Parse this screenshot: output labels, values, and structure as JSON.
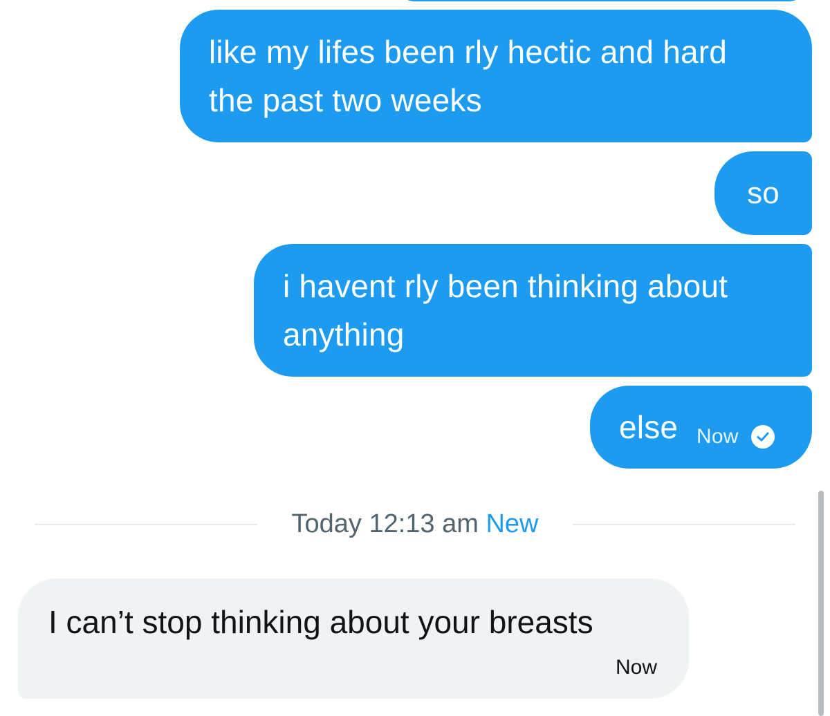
{
  "colors": {
    "sent_bubble": "#1d9bf0",
    "received_bubble": "#eff3f4",
    "divider_text": "#536471",
    "new_accent": "#1d9bf0"
  },
  "messages": [
    {
      "direction": "sent",
      "lines": [
        "like my lifes been rly hectic and hard",
        "the past two weeks"
      ]
    },
    {
      "direction": "sent",
      "lines": [
        "so"
      ]
    },
    {
      "direction": "sent",
      "lines": [
        "i havent rly been thinking about",
        "anything"
      ]
    },
    {
      "direction": "sent",
      "lines": [
        "else"
      ],
      "time": "Now",
      "status_icon": "check-circle-icon"
    }
  ],
  "divider": {
    "label": "Today 12:13 am",
    "new_label": "New"
  },
  "received": {
    "text": "I can’t stop thinking about your breasts",
    "time": "Now"
  }
}
